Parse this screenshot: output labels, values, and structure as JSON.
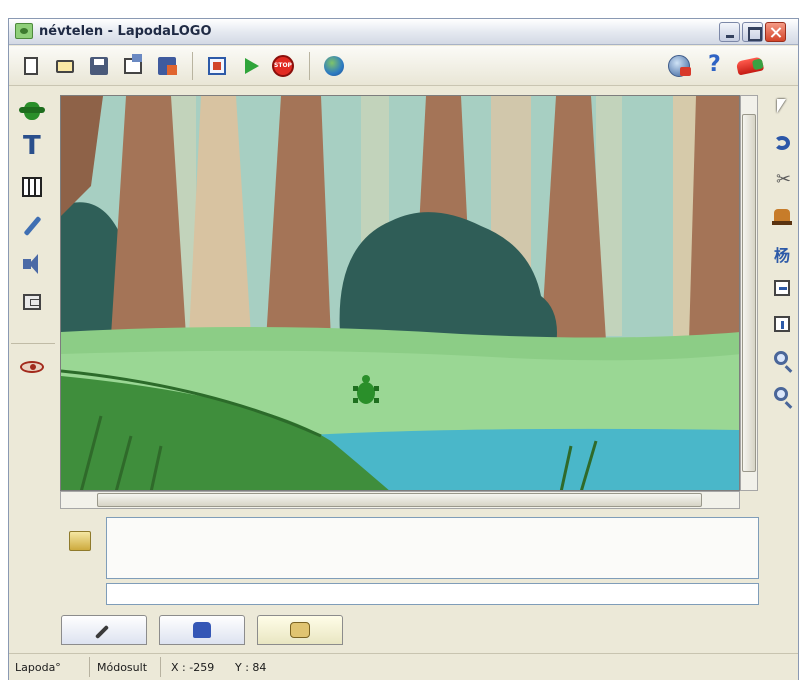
{
  "window": {
    "title": "névtelen - LapodaLOGO"
  },
  "toolbar": {
    "stop_label": "STOP",
    "help_glyph": "?",
    "icons": [
      "new-file-icon",
      "open-folder-icon",
      "save-icon",
      "save-as-icon",
      "export-icon",
      "fullscreen-icon",
      "play-icon",
      "stop-icon",
      "globe-icon",
      "web-icon",
      "help-icon",
      "exit-icon"
    ]
  },
  "left_tools": {
    "text_glyph": "T",
    "icons": [
      "turtle-icon",
      "text-icon",
      "piano-icon",
      "pencil-icon",
      "speaker-icon",
      "window-icon",
      "eye-icon"
    ]
  },
  "right_tools": {
    "glyph_label": "杨",
    "icons": [
      "pointer-icon",
      "undo-icon",
      "scissors-icon",
      "stamp-icon",
      "glyph-icon",
      "flip-vertical-icon",
      "flip-horizontal-icon",
      "zoom-in-icon",
      "zoom-out-icon"
    ]
  },
  "console": {
    "input_value": ""
  },
  "bottom_tabs": {
    "active": "scroll",
    "icons": [
      "brush-icon",
      "shirt-icon",
      "scroll-icon"
    ]
  },
  "status": {
    "app": "Lapoda°",
    "state": "Módosult",
    "x_label": "X : -259",
    "y_label": "Y : 84"
  },
  "colors": {
    "sky": "#b6d9c6",
    "tree_trunk": "#a8755a",
    "grass": "#7ec27a",
    "water": "#47b9c8",
    "turtle": "#2a8f2a"
  }
}
